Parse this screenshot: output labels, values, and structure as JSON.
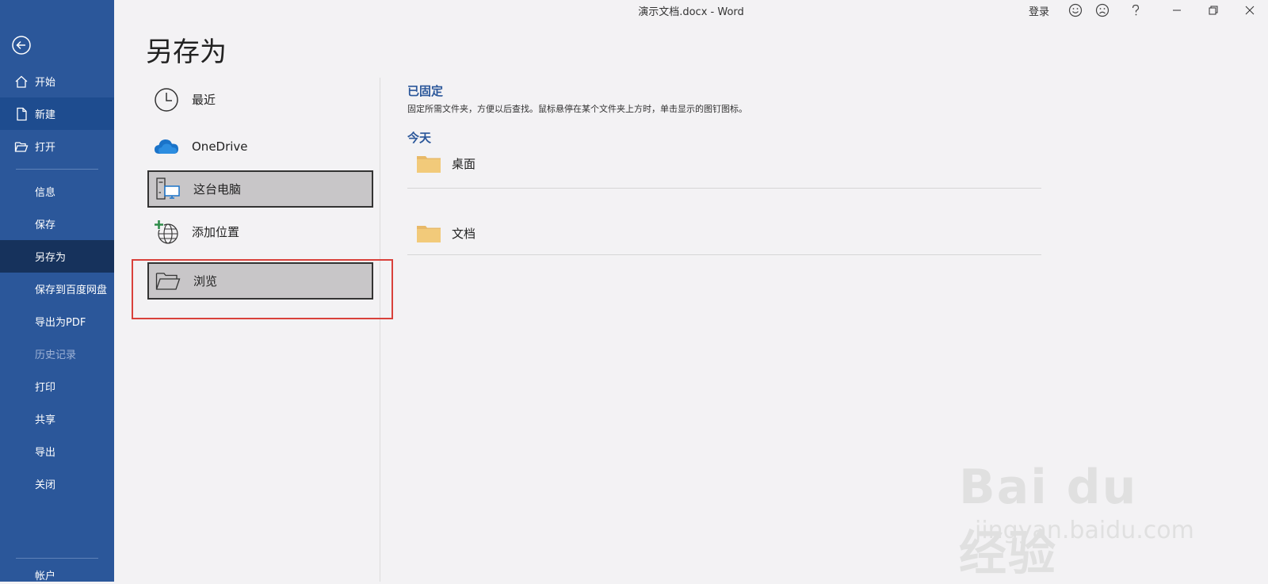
{
  "window": {
    "title": "演示文档.docx  -  Word",
    "signin_label": "登录"
  },
  "sidebar": {
    "items": [
      {
        "label": "开始"
      },
      {
        "label": "新建"
      },
      {
        "label": "打开"
      },
      {
        "label": "信息"
      },
      {
        "label": "保存"
      },
      {
        "label": "另存为"
      },
      {
        "label": "保存到百度网盘"
      },
      {
        "label": "导出为PDF"
      },
      {
        "label": "历史记录"
      },
      {
        "label": "打印"
      },
      {
        "label": "共享"
      },
      {
        "label": "导出"
      },
      {
        "label": "关闭"
      },
      {
        "label": "帐户"
      }
    ]
  },
  "page": {
    "title": "另存为"
  },
  "locations": {
    "items": [
      {
        "label": "最近",
        "icon": "clock-icon"
      },
      {
        "label": "OneDrive",
        "icon": "cloud-icon"
      },
      {
        "label": "这台电脑",
        "icon": "computer-icon"
      },
      {
        "label": "添加位置",
        "icon": "globe-add-icon"
      },
      {
        "label": "浏览",
        "icon": "folder-open-icon"
      }
    ]
  },
  "pinned": {
    "heading": "已固定",
    "description": "固定所需文件夹，方便以后查找。鼠标悬停在某个文件夹上方时，单击显示的图钉图标。"
  },
  "today": {
    "heading": "今天",
    "folders": [
      {
        "name": "桌面"
      },
      {
        "name": "文档"
      }
    ]
  },
  "watermark": {
    "brand": "Bai du 经验",
    "url": "jingyan.baidu.com"
  },
  "colors": {
    "sidebar": "#2b579a",
    "sidebar_active": "#16325c",
    "accent": "#2b579a",
    "highlight": "#d9413b",
    "folder": "#f2ca7a"
  }
}
